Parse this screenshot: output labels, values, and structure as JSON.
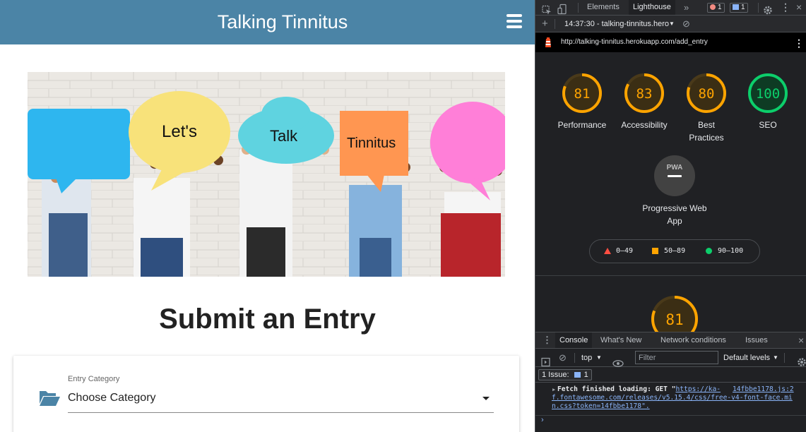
{
  "app": {
    "title": "Talking Tinnitus",
    "menu_icon": "hamburger-icon",
    "hero": {
      "bubble_texts": [
        "Let's",
        "Talk",
        "Tinnitus"
      ]
    },
    "heading": "Submit an Entry",
    "form": {
      "category_label": "Entry Category",
      "category_value": "Choose Category",
      "category_icon": "folder-open-icon"
    },
    "colors": {
      "header": "#4b84a6"
    }
  },
  "devtools": {
    "tabs": [
      "Elements",
      "Lighthouse"
    ],
    "active_tab": "Lighthouse",
    "errors_count": "1",
    "messages_count": "1",
    "report_selector": "14:37:30 - talking-tinnitus.hero",
    "url": "http://talking-tinnitus.herokuapp.com/add_entry",
    "scores": [
      {
        "label": "Performance",
        "value": "81",
        "score": 81,
        "status": "average"
      },
      {
        "label": "Accessibility",
        "value": "83",
        "score": 83,
        "status": "average"
      },
      {
        "label": "Best Practices",
        "value": "80",
        "score": 80,
        "status": "average"
      },
      {
        "label": "SEO",
        "value": "100",
        "score": 100,
        "status": "pass"
      }
    ],
    "pwa": {
      "badge": "PWA",
      "label": "Progressive Web App"
    },
    "legend": [
      "0–49",
      "50–89",
      "90–100"
    ],
    "section_score": {
      "value": "81",
      "score": 81
    },
    "status_colors": {
      "fail": "#ff4e42",
      "average": "#ffa400",
      "pass": "#0cce6b"
    },
    "drawer": {
      "tabs": [
        "Console",
        "What's New",
        "Network conditions",
        "Issues"
      ],
      "active_tab": "Console",
      "context": "top",
      "filter_placeholder": "Filter",
      "levels": "Default levels",
      "issues_label": "1 Issue:",
      "issues_count": "1",
      "log": {
        "message": "Fetch finished loading: GET \"",
        "url_start": "https://ka-",
        "source": "14fbbe1178.js:2",
        "continuation": "f.fontawesome.com/releases/v5.15.4/css/free-v4-font-face.mi\nn.css?token=14fbbe1178\"."
      }
    }
  }
}
